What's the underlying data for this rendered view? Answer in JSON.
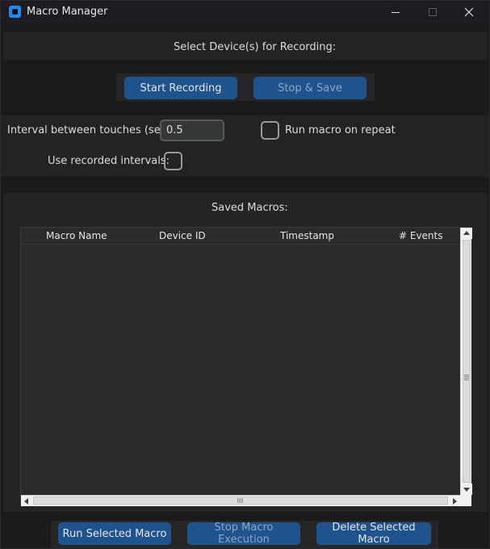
{
  "window": {
    "title": "Macro Manager",
    "app_icon": "app-icon"
  },
  "device_section": {
    "label": "Select Device(s) for Recording:"
  },
  "recording": {
    "start_label": "Start Recording",
    "stop_label": "Stop & Save"
  },
  "settings": {
    "interval_label": "Interval between touches (sec):",
    "interval_value": "0.5",
    "repeat_label": "Run macro on repeat",
    "repeat_checked": false,
    "use_recorded_label": "Use recorded intervals:",
    "use_recorded_checked": false
  },
  "saved": {
    "label": "Saved Macros:",
    "columns": [
      "Macro Name",
      "Device ID",
      "Timestamp",
      "# Events"
    ],
    "rows": []
  },
  "actions": {
    "run_label": "Run Selected Macro",
    "stop_label": "Stop Macro Execution",
    "delete_label": "Delete Selected Macro"
  },
  "colors": {
    "button_bg": "#1f538d",
    "window_bg": "#1b1b1b",
    "frame_bg": "#232323",
    "accent_icon": "#1a8cff"
  }
}
